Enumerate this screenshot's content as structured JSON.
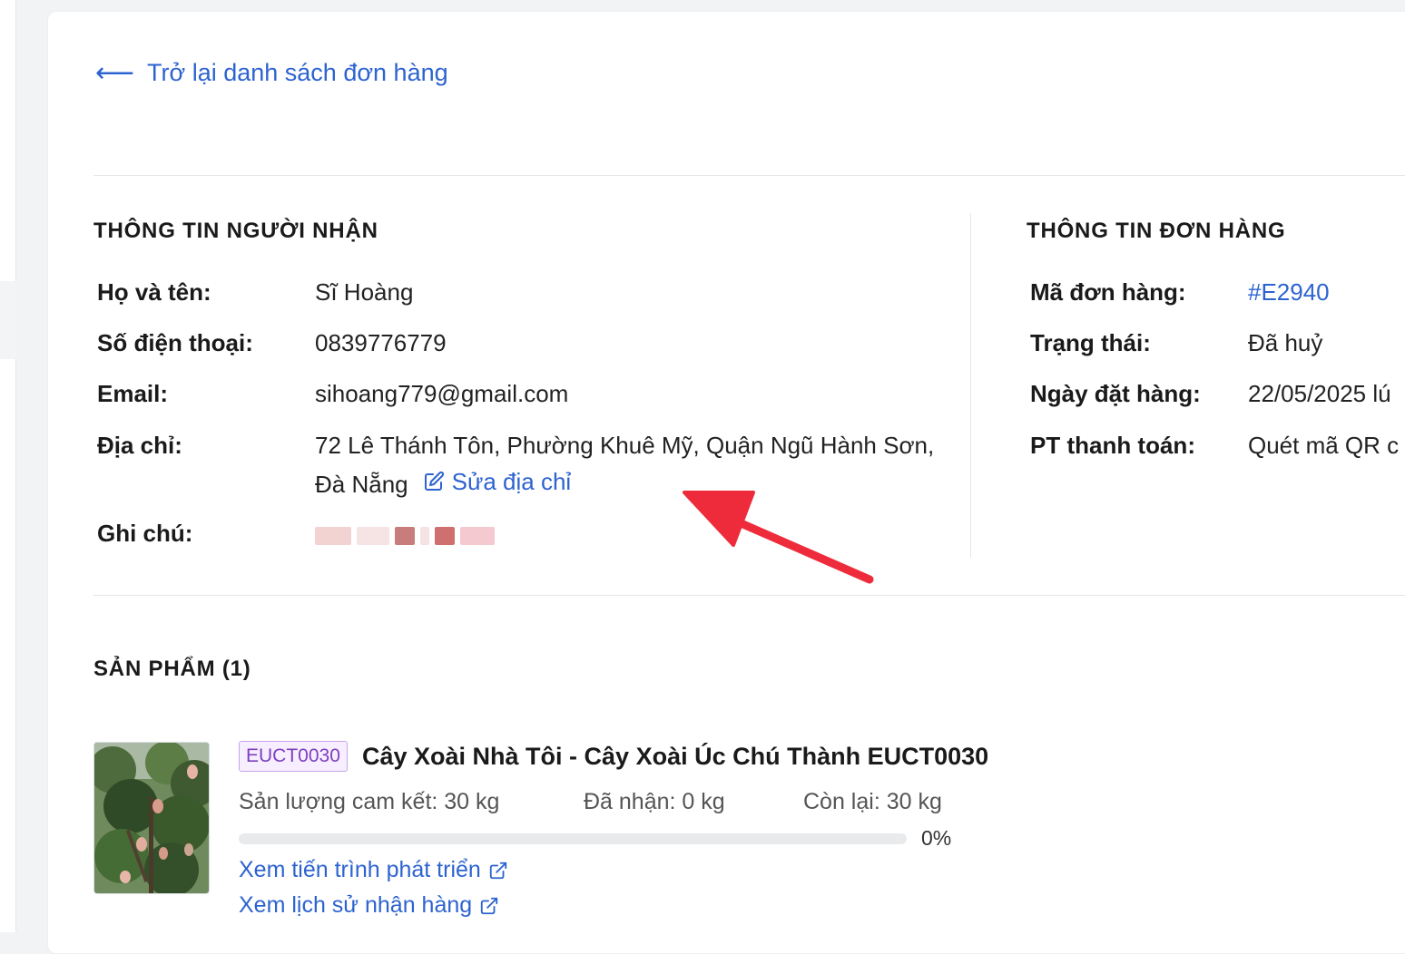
{
  "nav": {
    "back_label": "Trở lại danh sách đơn hàng",
    "back_icon": "arrow-left-icon"
  },
  "recipient": {
    "title": "THÔNG TIN NGƯỜI NHẬN",
    "name_label": "Họ và tên:",
    "name_value": "Sĩ Hoàng",
    "phone_label": "Số điện thoại:",
    "phone_value": "0839776779",
    "email_label": "Email:",
    "email_value": "sihoang779@gmail.com",
    "address_label": "Địa chỉ:",
    "address_value": "72 Lê Thánh Tôn, Phường Khuê Mỹ, Quận Ngũ Hành Sơn, Đà Nẵng",
    "edit_address_label": "Sửa địa chỉ",
    "edit_icon": "edit-icon",
    "note_label": "Ghi chú:"
  },
  "order": {
    "title": "THÔNG TIN ĐƠN HÀNG",
    "code_label": "Mã đơn hàng:",
    "code_value": "#E2940",
    "status_label": "Trạng thái:",
    "status_value": "Đã huỷ",
    "date_label": "Ngày đặt hàng:",
    "date_value": "22/05/2025 lú",
    "payment_label": "PT thanh toán:",
    "payment_value": "Quét mã QR c"
  },
  "products": {
    "title": "SẢN PHẨM (1)",
    "items": [
      {
        "sku": "EUCT0030",
        "name": "Cây Xoài Nhà Tôi - Cây Xoài Úc Chú Thành EUCT0030",
        "committed": "Sản lượng cam kết: 30 kg",
        "received": "Đã nhận: 0 kg",
        "remaining": "Còn lại: 30 kg",
        "progress_fraction": 0,
        "progress_label": "0%",
        "link_growth": "Xem tiến trình phát triển",
        "link_history": "Xem lịch sử nhận hàng",
        "link_icon": "external-link-icon"
      }
    ]
  },
  "colors": {
    "link": "#2d63d0",
    "annotation_arrow": "#ee2b3b",
    "badge_border": "#c8a4ea",
    "badge_text": "#7d3fc0"
  }
}
